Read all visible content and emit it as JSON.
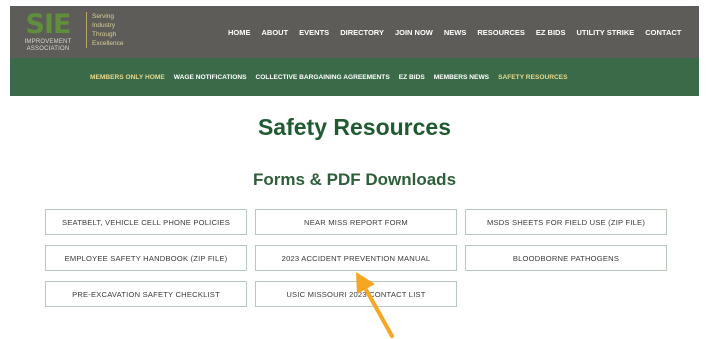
{
  "header": {
    "logo_text": "SIE",
    "logo_subtitle": "IMPROVEMENT ASSOCIATION",
    "tagline": [
      "Serving",
      "Industry",
      "Through",
      "Excellence"
    ],
    "nav": [
      "HOME",
      "ABOUT",
      "EVENTS",
      "DIRECTORY",
      "JOIN NOW",
      "NEWS",
      "RESOURCES",
      "EZ BIDS",
      "UTILITY STRIKE",
      "CONTACT"
    ]
  },
  "subnav": {
    "items": [
      "MEMBERS ONLY HOME",
      "WAGE NOTIFICATIONS",
      "COLLECTIVE BARGAINING AGREEMENTS",
      "EZ BIDS",
      "MEMBERS NEWS",
      "SAFETY RESOURCES"
    ]
  },
  "main": {
    "title": "Safety Resources",
    "section_title": "Forms & PDF Downloads",
    "buttons": [
      "SEATBELT, VEHICLE CELL PHONE POLICIES",
      "NEAR MISS REPORT FORM",
      "MSDS SHEETS FOR FIELD USE (ZIP FILE)",
      "EMPLOYEE SAFETY HANDBOOK (ZIP FILE)",
      "2023 ACCIDENT PREVENTION MANUAL",
      "BLOODBORNE PATHOGENS",
      "PRE-EXCAVATION SAFETY CHECKLIST",
      "USIC MISSOURI 2023 CONTACT LIST"
    ]
  },
  "colors": {
    "header_bg": "#5d5c58",
    "subnav_bg": "#3a6a48",
    "highlight": "#e8d98a",
    "title": "#1f5a31",
    "annotation_arrow": "#f5a623"
  }
}
